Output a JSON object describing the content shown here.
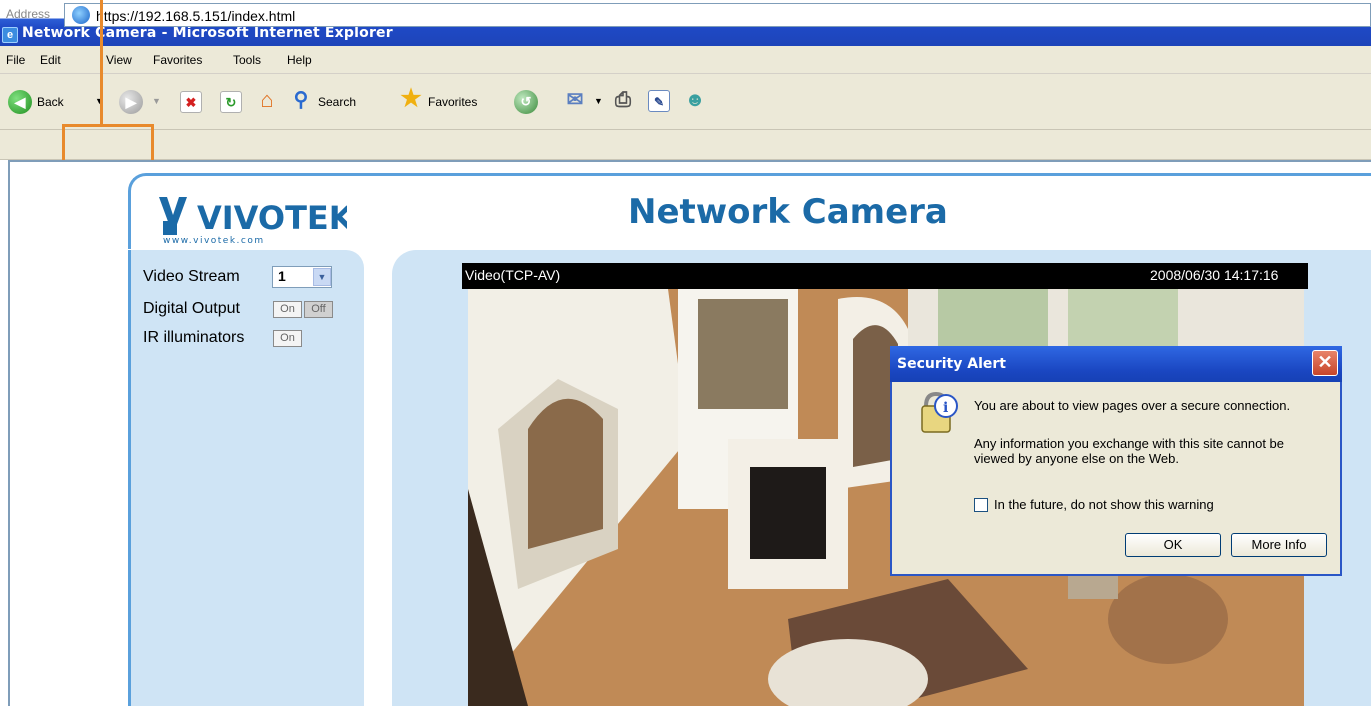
{
  "window": {
    "title": "Network Camera - Microsoft Internet Explorer"
  },
  "menu": {
    "items": [
      "File",
      "Edit",
      "View",
      "Favorites",
      "Tools",
      "Help"
    ]
  },
  "toolbar": {
    "back_label": "Back",
    "search_label": "Search",
    "favorites_label": "Favorites"
  },
  "address": {
    "label": "Address",
    "url": "https://192.168.5.151/index.html"
  },
  "page": {
    "logo_text": "VIVOTEK",
    "logo_subtext": "www.vivotek.com",
    "title": "Network Camera",
    "controls": {
      "video_stream_label": "Video Stream",
      "video_stream_value": "1",
      "digital_output_label": "Digital Output",
      "on_label": "On",
      "off_label": "Off",
      "ir_label": "IR illuminators"
    },
    "video": {
      "label": "Video(TCP-AV)",
      "timestamp": "2008/06/30 14:17:16"
    }
  },
  "dialog": {
    "title": "Security Alert",
    "message1": "You are about to view pages over a secure connection.",
    "message2": "Any information you exchange with this site cannot be viewed by anyone else on the Web.",
    "checkbox_label": "In the future, do not show this warning",
    "ok_label": "OK",
    "more_info_label": "More Info"
  },
  "colors": {
    "titlebar_blue": "#1f49c5",
    "highlight_orange": "#e88a2c",
    "brand_blue": "#1b6aa7",
    "panel_blue": "#cfe4f5"
  }
}
